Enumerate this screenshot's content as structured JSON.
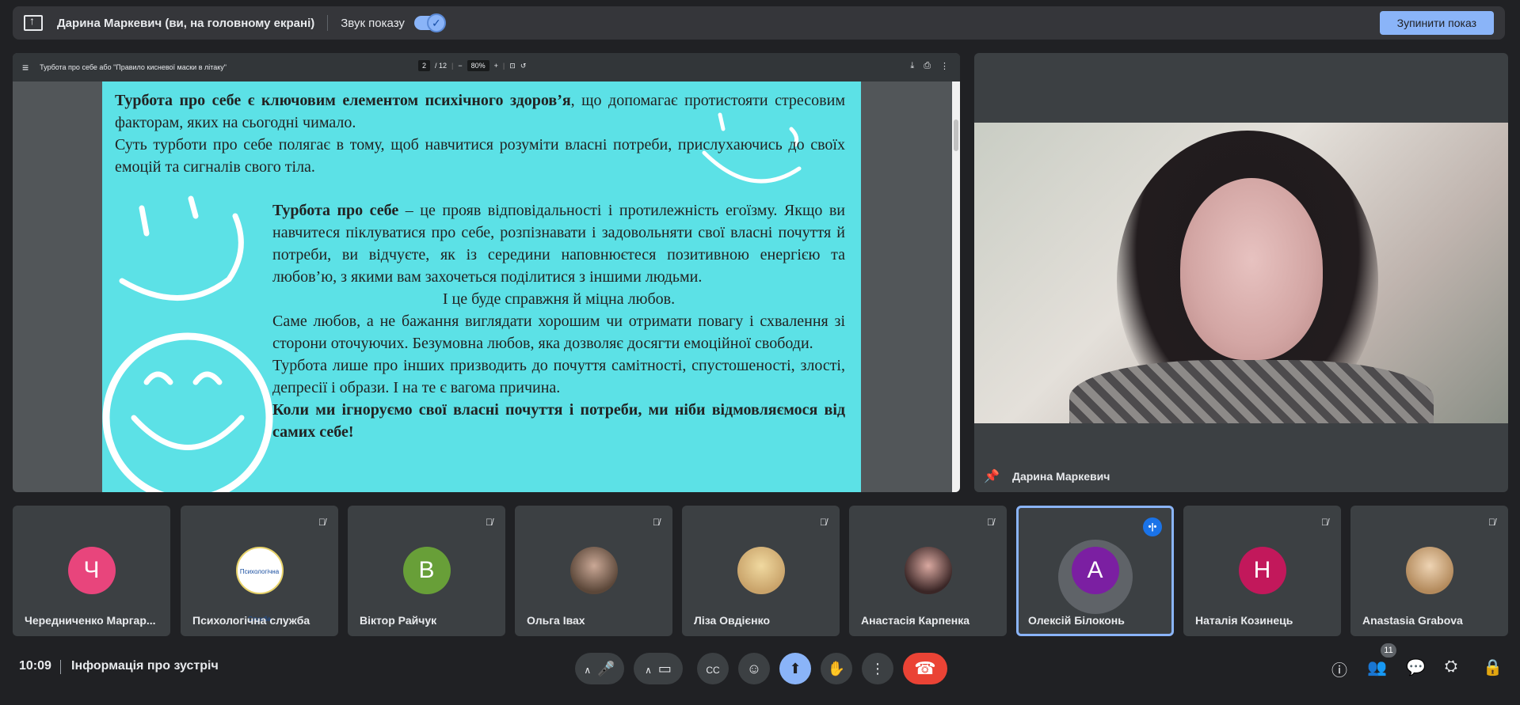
{
  "topbar": {
    "presenter_title": "Дарина Маркевич (ви, на головному екрані)",
    "sound_label": "Звук показу",
    "stop_button": "Зупинити показ"
  },
  "pdf": {
    "doc_title": "Турбота про себе або \"Правило кисневої маски в літаку\"",
    "page_current": "2",
    "page_total": "/ 12",
    "zoom": "80%",
    "paragraph1_bold": "Турбота про себе є ключовим елементом психічного здоров’я",
    "paragraph1_rest": ", що допомагає протистояти стресовим факторам, яких на сьогодні чимало.",
    "paragraph2": "Суть турботи про себе полягає в тому, щоб навчитися розуміти власні потреби, прислухаючись до своїх емоцій та сигналів свого тіла.",
    "paragraph3_bold": "Турбота про себе",
    "paragraph3_rest": " – це прояв відповідальності і протилежність егоїзму. Якщо ви навчитеся піклуватися про себе, розпізнавати і задовольняти свої власні почуття й потреби, ви відчуєте, як із середини наповнюєтеся позитивною енергією та любов’ю, з якими вам захочеться поділитися з іншими людьми.",
    "center_line": "І це буде справжня й міцна любов.",
    "paragraph4": "Саме любов, а не бажання виглядати хорошим чи отримати повагу і схвалення зі сторони оточуючих. Безумовна любов, яка дозволяє досягти емоційної свободи.",
    "paragraph5": "Турбота лише про інших призводить до почуття самітності, спустошеності, злості, депресії і образи. І на те є вагома причина.",
    "paragraph6_bold": "Коли ми ігноруємо свої власні почуття і потреби, ми ніби відмовляємося від самих себе!"
  },
  "speaker": {
    "name": "Дарина Маркевич"
  },
  "participants": [
    {
      "name": "Чередниченко Маргар...",
      "initial": "Ч",
      "color": "#e8457c",
      "type": "letter",
      "muted": false
    },
    {
      "name": "Психологічна служба",
      "initial": "Психологічна Служба",
      "type": "logo",
      "muted": true
    },
    {
      "name": "Віктор Райчук",
      "initial": "В",
      "color": "#689f38",
      "type": "letter",
      "muted": true
    },
    {
      "name": "Ольга Івах",
      "type": "photo",
      "muted": true
    },
    {
      "name": "Ліза Овдієнко",
      "type": "photo",
      "muted": true
    },
    {
      "name": "Анастасія Карпенка",
      "type": "photo",
      "muted": true
    },
    {
      "name": "Олексій Білоконь",
      "initial": "А",
      "color": "#7b1fa2",
      "type": "letter",
      "speaking": true
    },
    {
      "name": "Наталія Козинець",
      "initial": "Н",
      "color": "#c2185b",
      "type": "letter",
      "muted": true
    },
    {
      "name": "Anastasia Grabova",
      "type": "photo",
      "muted": true
    }
  ],
  "bottombar": {
    "time": "10:09",
    "meeting_info": "Інформація про зустріч",
    "participant_count": "11"
  },
  "colors": {
    "accent": "#8ab4f8",
    "end_call": "#ea4335",
    "page_bg": "#5ce1e6"
  }
}
